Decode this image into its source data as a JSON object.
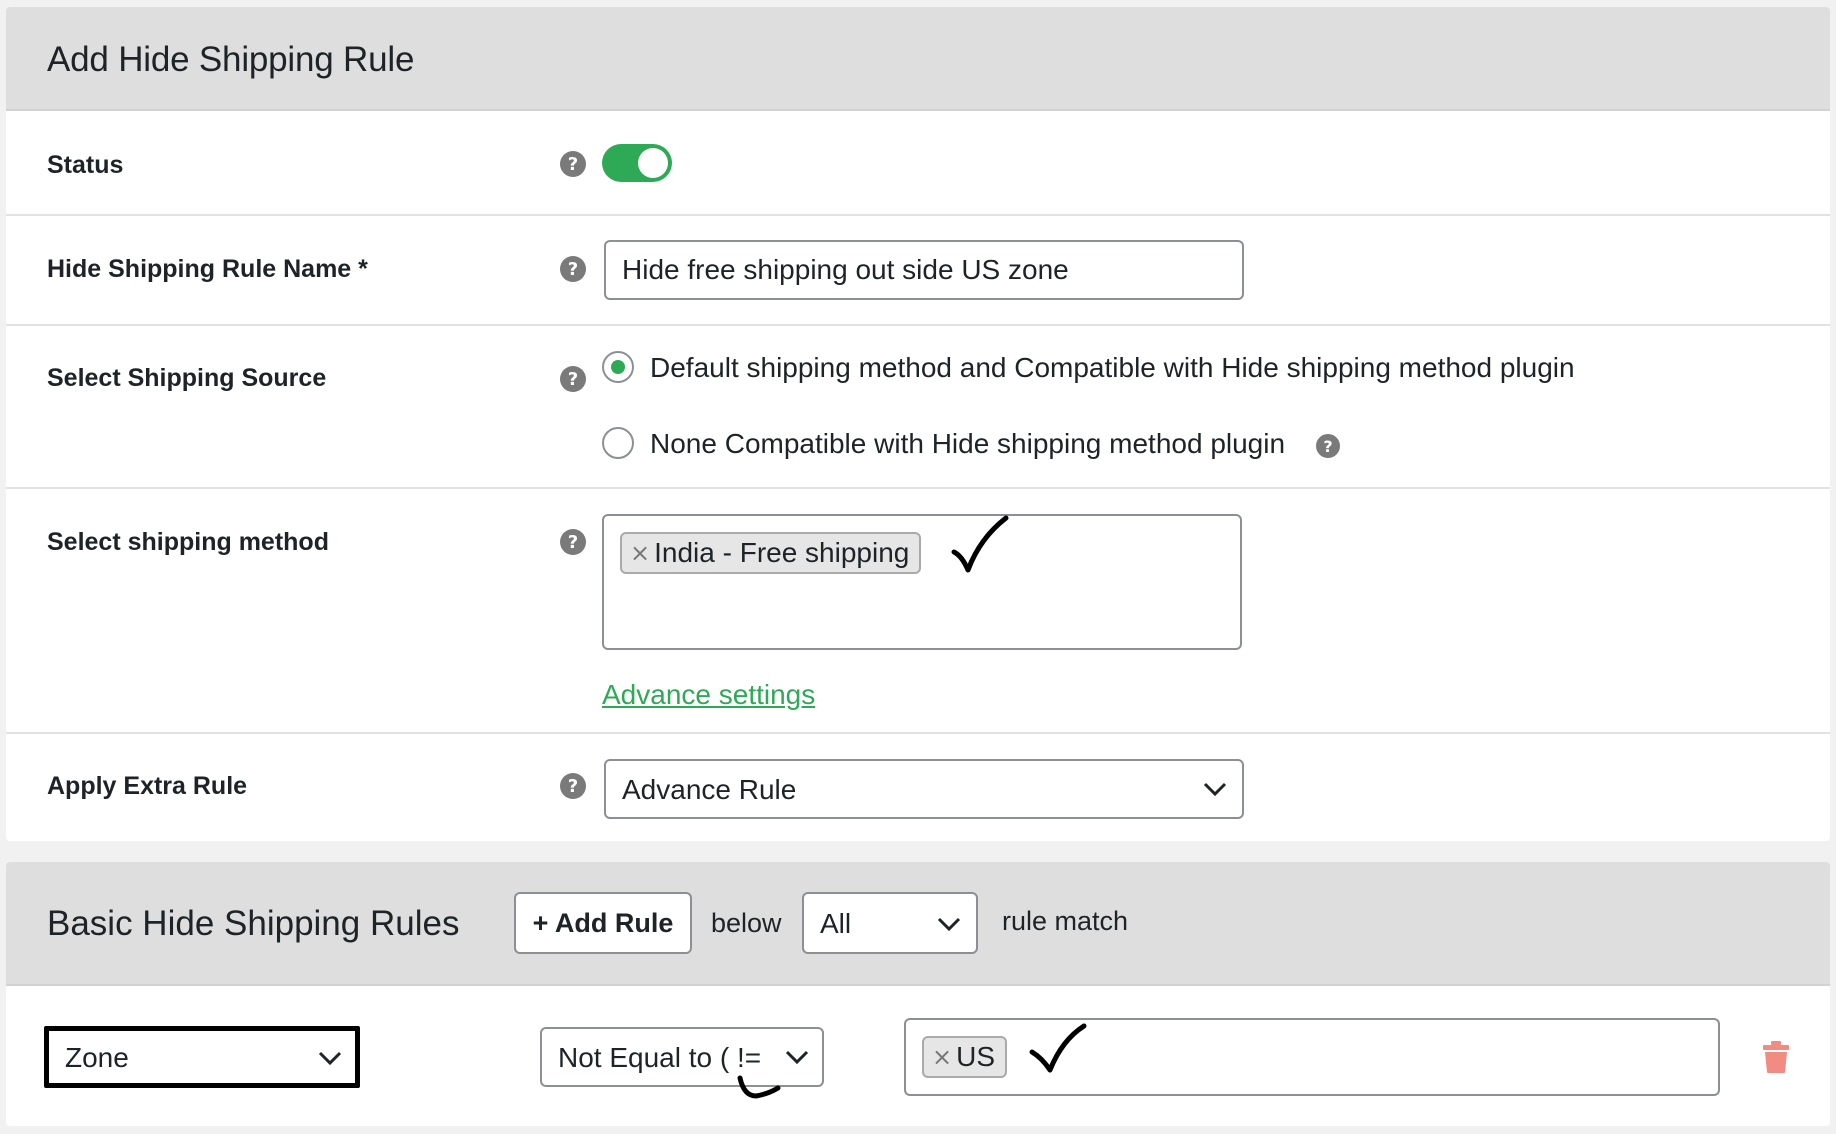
{
  "form": {
    "title": "Add Hide Shipping Rule",
    "help_glyph": "?",
    "status": {
      "label": "Status",
      "enabled": true
    },
    "rule_name": {
      "label": "Hide Shipping Rule Name *",
      "value": "Hide free shipping out side US zone"
    },
    "shipping_source": {
      "label": "Select Shipping Source",
      "options": [
        {
          "label": "Default shipping method and Compatible with Hide shipping method plugin",
          "checked": true
        },
        {
          "label": "None Compatible with Hide shipping method plugin",
          "checked": false
        }
      ]
    },
    "shipping_method": {
      "label": "Select shipping method",
      "chips": [
        {
          "label": "India - Free shipping",
          "remove": "×"
        }
      ],
      "advance_link": "Advance settings"
    },
    "extra_rule": {
      "label": "Apply Extra Rule",
      "value": "Advance Rule"
    }
  },
  "rules": {
    "title": "Basic Hide Shipping Rules",
    "add_button": "+ Add Rule",
    "below_text": "below",
    "match_select": "All",
    "match_text": "rule match",
    "row": {
      "field": "Zone",
      "operator": "Not Equal to ( !=",
      "chips": [
        {
          "label": "US",
          "remove": "×"
        }
      ]
    }
  },
  "colors": {
    "accent": "#2eaa56",
    "delete": "#f28b82",
    "header_bg": "#dedede"
  },
  "icons": [
    "help-icon",
    "toggle-switch",
    "chevron-down-icon",
    "close-icon",
    "trash-icon",
    "checkmark-annotation"
  ]
}
